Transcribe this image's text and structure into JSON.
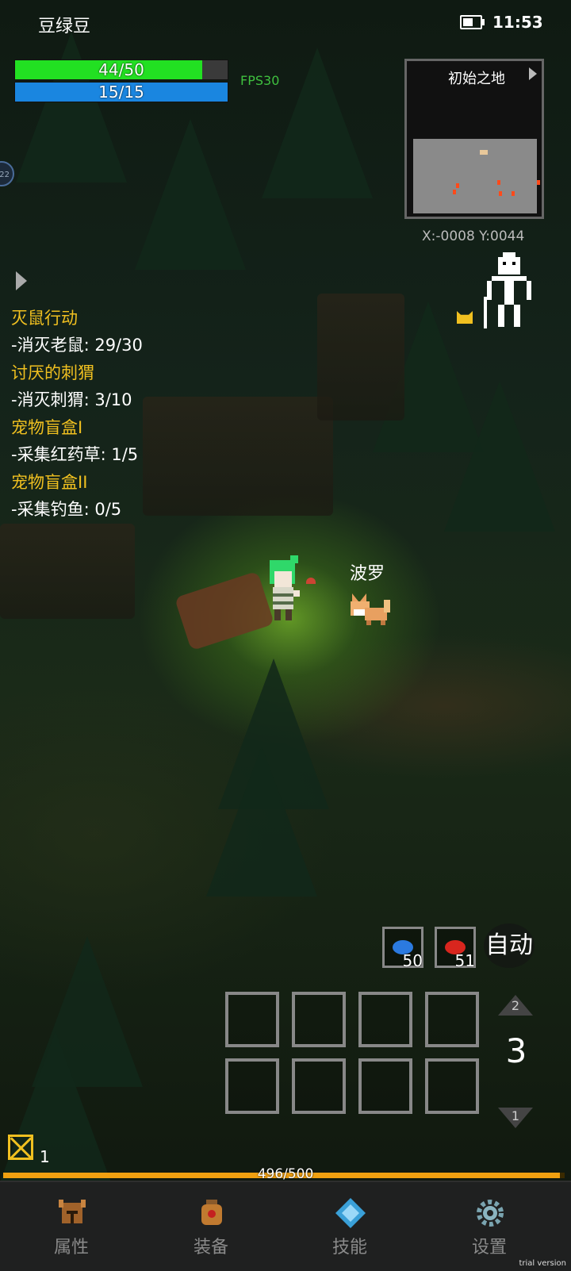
{
  "status": {
    "player_name": "豆绿豆",
    "time": "11:53"
  },
  "hud": {
    "hp_text": "44/50",
    "hp_fraction": 0.88,
    "mp_text": "15/15",
    "mp_fraction": 1.0,
    "fps": "FPS30",
    "side_tab_label": "22"
  },
  "quests": [
    {
      "title": "灭鼠行动",
      "objective": "-消灭老鼠: 29/30"
    },
    {
      "title": "讨厌的刺猬",
      "objective": "-消灭刺猬: 3/10"
    },
    {
      "title": "宠物盲盒I",
      "objective": "-采集红药草: 1/5"
    },
    {
      "title": "宠物盲盒II",
      "objective": "-采集钓鱼: 0/5"
    }
  ],
  "minimap": {
    "title": "初始之地",
    "coords": "X:-0008  Y:0044"
  },
  "world": {
    "pet_name": "波罗"
  },
  "potions": {
    "blue_count": "50",
    "red_count": "51"
  },
  "auto_button": "自动",
  "skill_page": {
    "up_label": "2",
    "current": "3",
    "down_label": "1"
  },
  "bag": {
    "count": "1"
  },
  "exp": {
    "text": "496/500",
    "fraction": 0.992
  },
  "nav": [
    {
      "label": "属性",
      "icon": "helmet-icon"
    },
    {
      "label": "装备",
      "icon": "bag-icon"
    },
    {
      "label": "技能",
      "icon": "crystal-icon"
    },
    {
      "label": "设置",
      "icon": "gear-icon"
    }
  ],
  "watermark": "trial version",
  "colors": {
    "quest_title": "#f0c020",
    "hp": "#22e022",
    "mp": "#1a86e0",
    "exp": "#f0a010"
  }
}
